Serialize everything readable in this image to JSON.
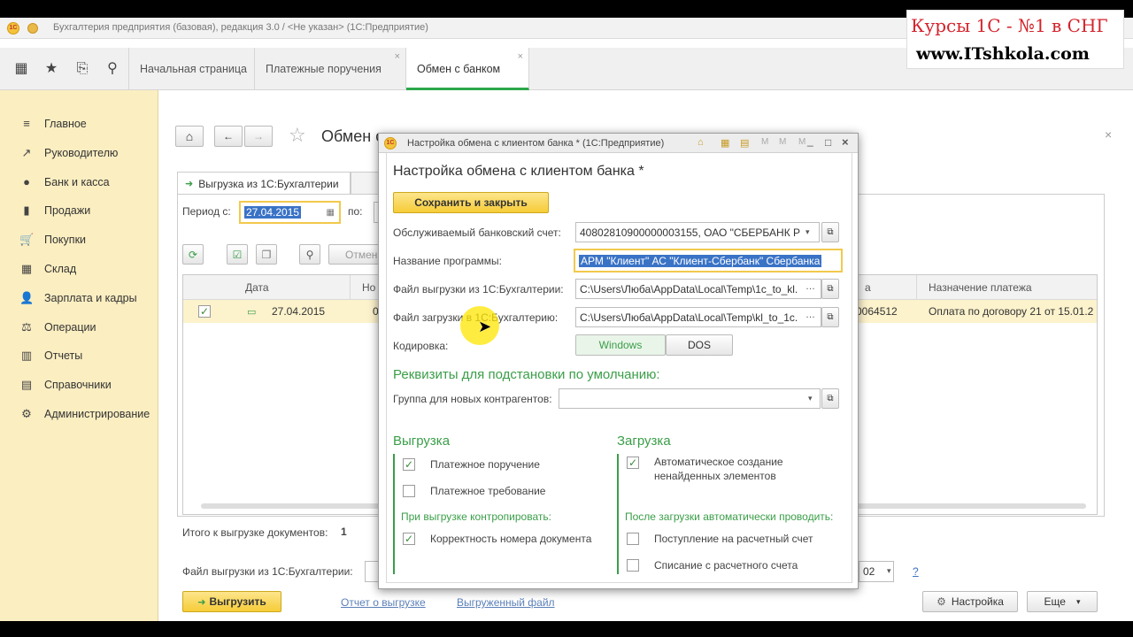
{
  "window": {
    "title": "Бухгалтерия предприятия (базовая), редакция 3.0 / <Не указан> (1С:Предприятие)"
  },
  "tabs": [
    {
      "label": "Начальная страница"
    },
    {
      "label": "Платежные поручения"
    },
    {
      "label": "Обмен с банком"
    }
  ],
  "sidebar": {
    "items": [
      {
        "label": "Главное",
        "icon": "≡"
      },
      {
        "label": "Руководителю",
        "icon": "↗"
      },
      {
        "label": "Банк и касса",
        "icon": "●"
      },
      {
        "label": "Продажи",
        "icon": "▮"
      },
      {
        "label": "Покупки",
        "icon": "🛒"
      },
      {
        "label": "Склад",
        "icon": "▦"
      },
      {
        "label": "Зарплата и кадры",
        "icon": "👤"
      },
      {
        "label": "Операции",
        "icon": "⚖"
      },
      {
        "label": "Отчеты",
        "icon": "▥"
      },
      {
        "label": "Справочники",
        "icon": "▤"
      },
      {
        "label": "Администрирование",
        "icon": "⚙"
      }
    ]
  },
  "form": {
    "title": "Обмен с",
    "subtab_label": "Выгрузка из 1С:Бухгалтерии",
    "period_label": "Период с:",
    "period_from": "27.04.2015",
    "period_to_label": "по:",
    "cancel_label": "Отмен",
    "table": {
      "columns": [
        "Дата",
        "Но",
        "а",
        "Назначение платежа"
      ],
      "rows": [
        {
          "date": "27.04.2015",
          "num": "0",
          "account": "0064512",
          "purpose": "Оплата по договору 21 от 15.01.2"
        }
      ]
    },
    "total_label": "Итого к выгрузке документов:",
    "total_value": "1",
    "file_label": "Файл выгрузки из 1С:Бухгалтерии:",
    "encoding_tail": "02",
    "help": "?",
    "export_button": "Выгрузить",
    "report_link": "Отчет о выгрузке",
    "file_link": "Выгруженный файл",
    "settings_button": "Настройка",
    "more_button": "Еще"
  },
  "dialog": {
    "window_title": "Настройка обмена с клиентом банка * (1С:Предприятие)",
    "title": "Настройка обмена с клиентом банка *",
    "save_close": "Сохранить и закрыть",
    "bank_account_label": "Обслуживаемый банковский счет:",
    "bank_account_value": "40802810900000003155, ОАО \"СБЕРБАНК Р",
    "program_label": "Название программы:",
    "program_value": "АРМ \"Клиент\" АС \"Клиент-Сбербанк\" Сбербанка",
    "export_file_label": "Файл выгрузки из 1С:Бухгалтерии:",
    "export_file_value": "C:\\Users\\Люба\\AppData\\Local\\Temp\\1c_to_kl.",
    "import_file_label": "Файл загрузки в 1С:Бухгалтерию:",
    "import_file_value": "C:\\Users\\Люба\\AppData\\Local\\Temp\\kl_to_1c.",
    "encoding_label": "Кодировка:",
    "encoding_windows": "Windows",
    "encoding_dos": "DOS",
    "defaults_heading": "Реквизиты для подстановки по умолчанию:",
    "group_label": "Группа для новых контрагентов:",
    "export_heading": "Выгрузка",
    "export_items": [
      {
        "label": "Платежное поручение",
        "checked": true
      },
      {
        "label": "Платежное требование",
        "checked": false
      }
    ],
    "control_heading": "При выгрузке контропировать:",
    "control_items": [
      {
        "label": "Корректность номера документа",
        "checked": true
      }
    ],
    "import_heading": "Загрузка",
    "import_auto_label_1": "Автоматическое создание",
    "import_auto_label_2": "ненайденных элементов",
    "post_heading": "После загрузки автоматически проводить:",
    "post_items": [
      {
        "label": "Поступление на расчетный счет",
        "checked": false
      },
      {
        "label": "Списание с расчетного счета",
        "checked": false
      }
    ]
  },
  "watermark": {
    "line1": "Курсы 1С - №1 в СНГ",
    "line2": "www.ITshkola.com"
  },
  "colors": {
    "accent_green": "#3a9e48",
    "sidebar_bg": "#fbeec1",
    "button_yellow": "#f6cc38",
    "selection_blue": "#3a73c6",
    "watermark_red": "#d4232b"
  }
}
